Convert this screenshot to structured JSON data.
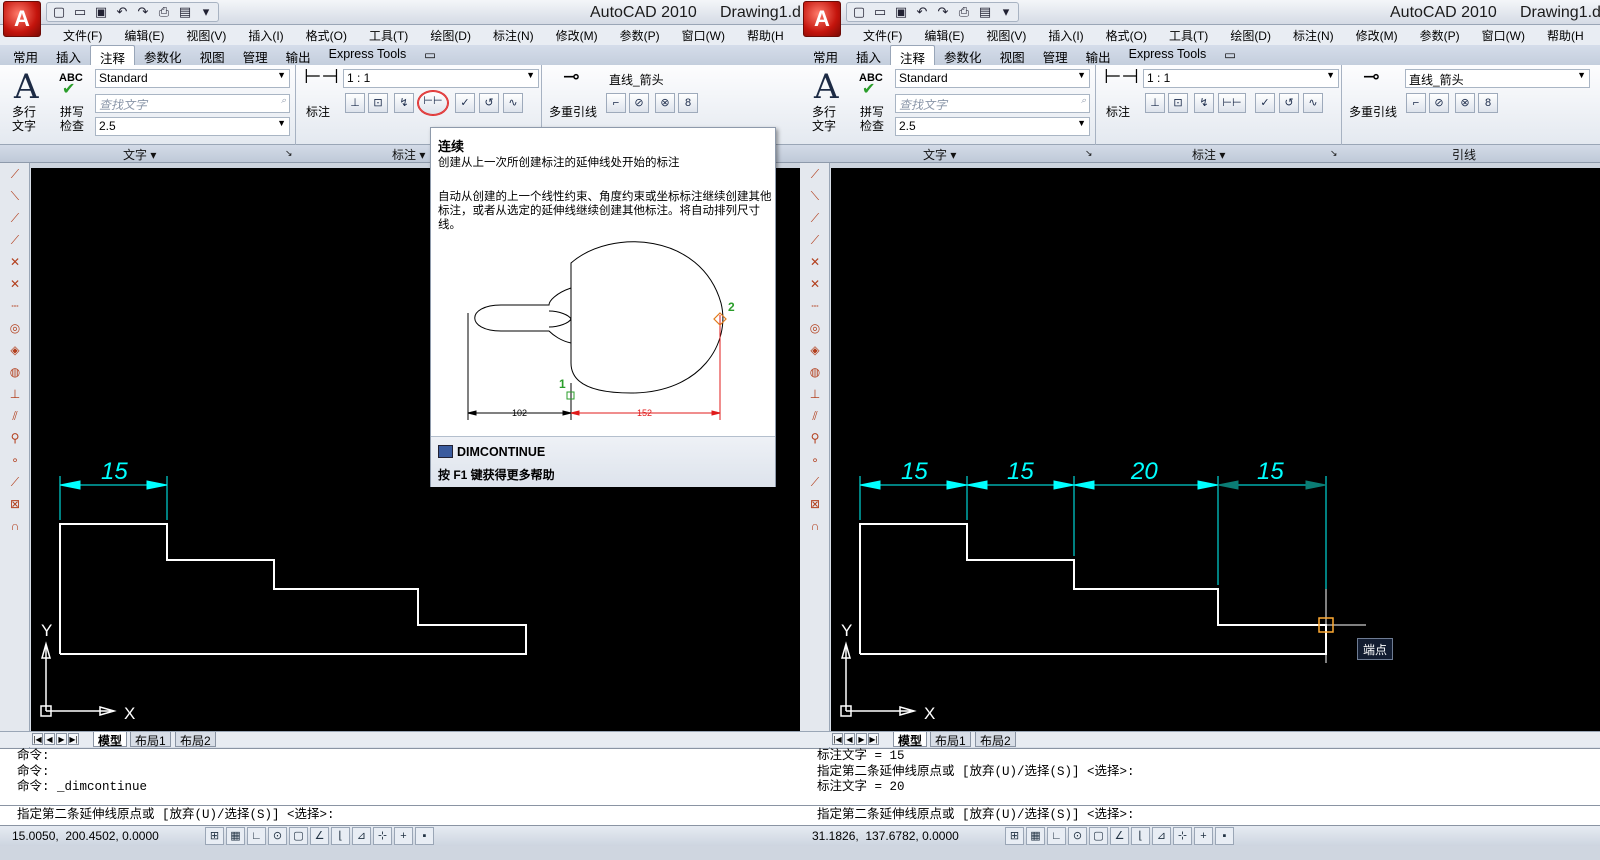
{
  "left": {
    "title": {
      "app": "AutoCAD 2010",
      "doc": "Drawing1.d"
    },
    "menus": [
      "文件(F)",
      "编辑(E)",
      "视图(V)",
      "插入(I)",
      "格式(O)",
      "工具(T)",
      "绘图(D)",
      "标注(N)",
      "修改(M)",
      "参数(P)",
      "窗口(W)",
      "帮助(H"
    ],
    "tabs": [
      "常用",
      "插入",
      "注释",
      "参数化",
      "视图",
      "管理",
      "输出",
      "Express Tools"
    ],
    "active_tab": "注释",
    "ribbon": {
      "mtext_label_1": "多行",
      "mtext_label_2": "文字",
      "spell_abc": "ABC",
      "spell_label_1": "拼写",
      "spell_label_2": "检查",
      "text_style": "Standard",
      "find_placeholder": "查找文字",
      "text_height": "2.5",
      "dim_label": "标注",
      "dim_scale": "1 : 1",
      "leader_label": "多重引线",
      "leader_style": "直线_箭头"
    },
    "panels": [
      "文字",
      "标注"
    ],
    "layout_tabs": [
      "模型",
      "布局1",
      "布局2"
    ],
    "command_lines": [
      "命令:",
      "命令:",
      "命令: _dimcontinue"
    ],
    "prompt": "指定第二条延伸线原点或 [放弃(U)/选择(S)] <选择>:",
    "coords": "15.0050,  200.4502, 0.0000",
    "drawing": {
      "dim_text": "15",
      "axis_x": "X",
      "axis_y": "Y"
    },
    "tooltip": {
      "title": "连续",
      "desc": "创建从上一次所创建标注的延伸线处开始的标注",
      "body": "自动从创建的上一个线性约束、角度约束或坐标标注继续创建其他标注，或者从选定的延伸线继续创建其他标注。将自动排列尺寸线。",
      "pt1": "1",
      "pt2": "2",
      "dim1": "102",
      "dim2": "152",
      "command": "DIMCONTINUE",
      "help": "按 F1 键获得更多帮助"
    }
  },
  "right": {
    "title": {
      "app": "AutoCAD 2010",
      "doc": "Drawing1.d"
    },
    "menus": [
      "文件(F)",
      "编辑(E)",
      "视图(V)",
      "插入(I)",
      "格式(O)",
      "工具(T)",
      "绘图(D)",
      "标注(N)",
      "修改(M)",
      "参数(P)",
      "窗口(W)",
      "帮助(H"
    ],
    "tabs": [
      "常用",
      "插入",
      "注释",
      "参数化",
      "视图",
      "管理",
      "输出",
      "Express Tools"
    ],
    "active_tab": "注释",
    "ribbon": {
      "mtext_label_1": "多行",
      "mtext_label_2": "文字",
      "spell_abc": "ABC",
      "spell_label_1": "拼写",
      "spell_label_2": "检查",
      "text_style": "Standard",
      "find_placeholder": "查找文字",
      "text_height": "2.5",
      "dim_label": "标注",
      "dim_scale": "1 : 1",
      "leader_label": "多重引线",
      "leader_style": "直线_箭头"
    },
    "panels": [
      "文字",
      "标注",
      "引线"
    ],
    "layout_tabs": [
      "模型",
      "布局1",
      "布局2"
    ],
    "command_lines": [
      "标注文字 = 15",
      "指定第二条延伸线原点或 [放弃(U)/选择(S)] <选择>:",
      "标注文字 = 20"
    ],
    "prompt": "指定第二条延伸线原点或 [放弃(U)/选择(S)] <选择>:",
    "coords": "31.1826,  137.6782, 0.0000",
    "drawing": {
      "dims": [
        "15",
        "15",
        "20",
        "15"
      ],
      "axis_x": "X",
      "axis_y": "Y",
      "snap_tip": "端点"
    }
  },
  "colors": {
    "dimension": "#00ffff",
    "geometry": "#ffffff",
    "canvas": "#000000",
    "snap": "#ffaa33"
  }
}
